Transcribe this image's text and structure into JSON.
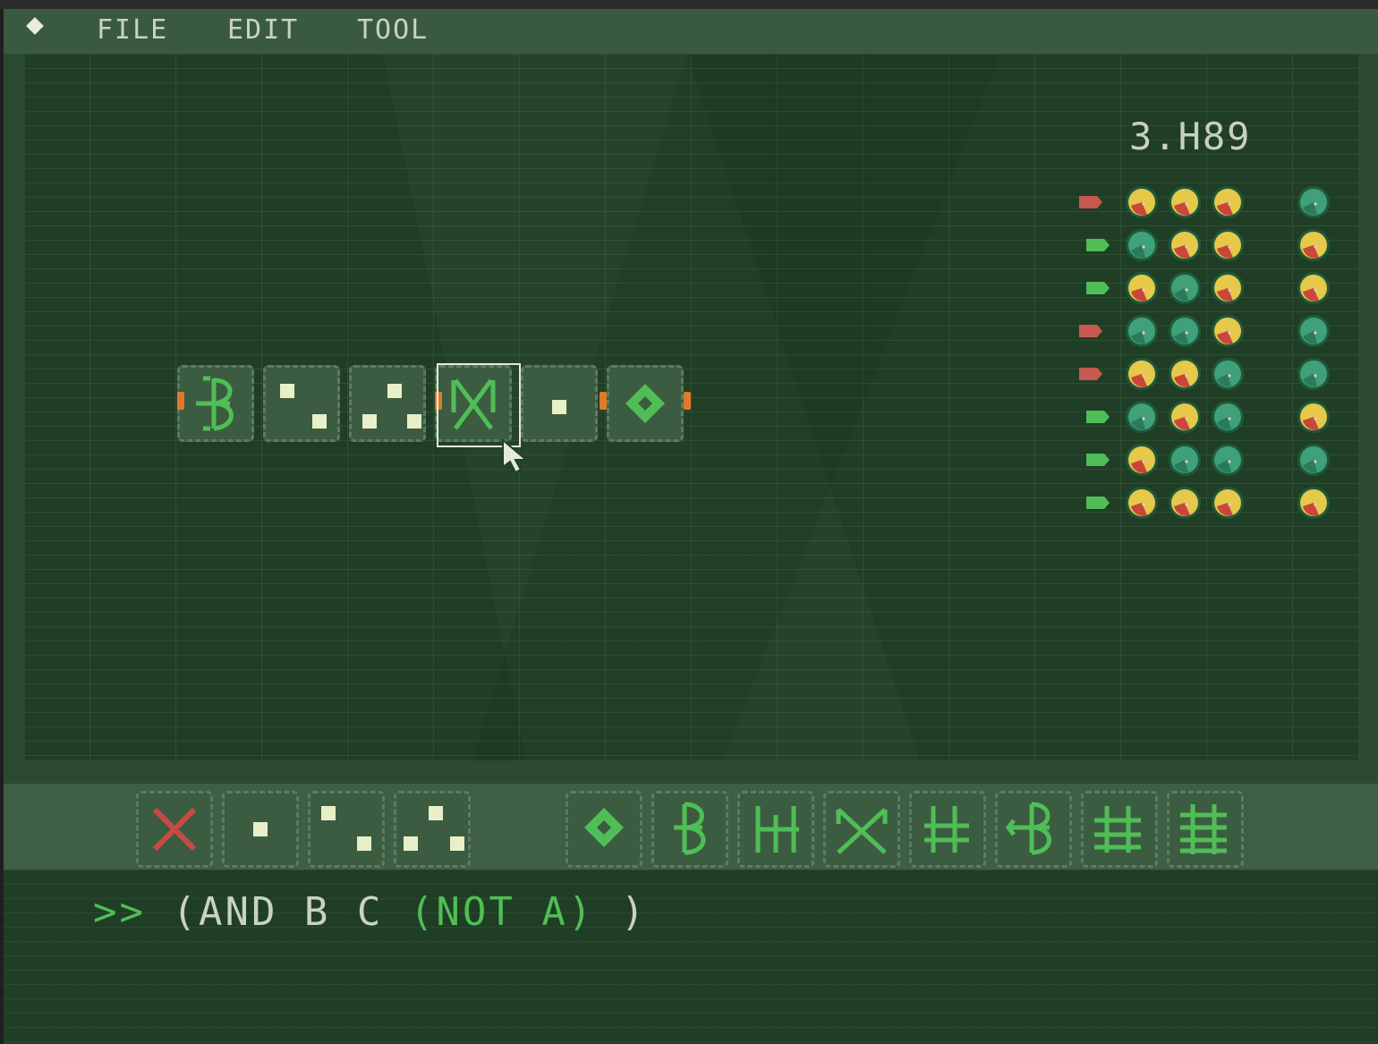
{
  "menu": {
    "items": [
      "FILE",
      "EDIT",
      "TOOL"
    ]
  },
  "board": {
    "score": "3.H89",
    "circuit_tiles": [
      "b-gate",
      "dots-two",
      "dots-three",
      "x-gate",
      "dot-one",
      "diamond"
    ],
    "selected_tile": 3
  },
  "truth_table": {
    "rows": [
      {
        "flag": "red",
        "inputs": [
          "yellow",
          "yellow",
          "yellow"
        ],
        "output": "teal"
      },
      {
        "flag": "green",
        "inputs": [
          "teal",
          "yellow",
          "yellow"
        ],
        "output": "yellow"
      },
      {
        "flag": "green",
        "inputs": [
          "yellow",
          "teal",
          "yellow"
        ],
        "output": "yellow"
      },
      {
        "flag": "red",
        "inputs": [
          "teal",
          "teal",
          "yellow"
        ],
        "output": "teal"
      },
      {
        "flag": "red",
        "inputs": [
          "yellow",
          "yellow",
          "teal"
        ],
        "output": "teal"
      },
      {
        "flag": "green",
        "inputs": [
          "teal",
          "yellow",
          "teal"
        ],
        "output": "yellow"
      },
      {
        "flag": "green",
        "inputs": [
          "yellow",
          "teal",
          "teal"
        ],
        "output": "teal"
      },
      {
        "flag": "green",
        "inputs": [
          "yellow",
          "yellow",
          "yellow"
        ],
        "output": "yellow"
      }
    ]
  },
  "palette": {
    "items": [
      "delete",
      "dot-one",
      "dots-two",
      "dots-three",
      "diamond",
      "b-gate",
      "pipe-gate",
      "x-gate",
      "double-bar-gate",
      "arrow-b-gate",
      "triple-bar-gate",
      "quad-bar-gate"
    ]
  },
  "console": {
    "prompt_symbol": ">>",
    "expression_part1": "(AND B C ",
    "expression_part2": "(NOT A)",
    "expression_part3": " )"
  },
  "colors": {
    "accent_green": "#4fbe56",
    "orb_yellow": "#e6c84a",
    "orb_teal": "#3fa07a",
    "flag_red": "#c75a4e",
    "flag_green": "#4fbe56",
    "delete_red": "#c94a45"
  }
}
